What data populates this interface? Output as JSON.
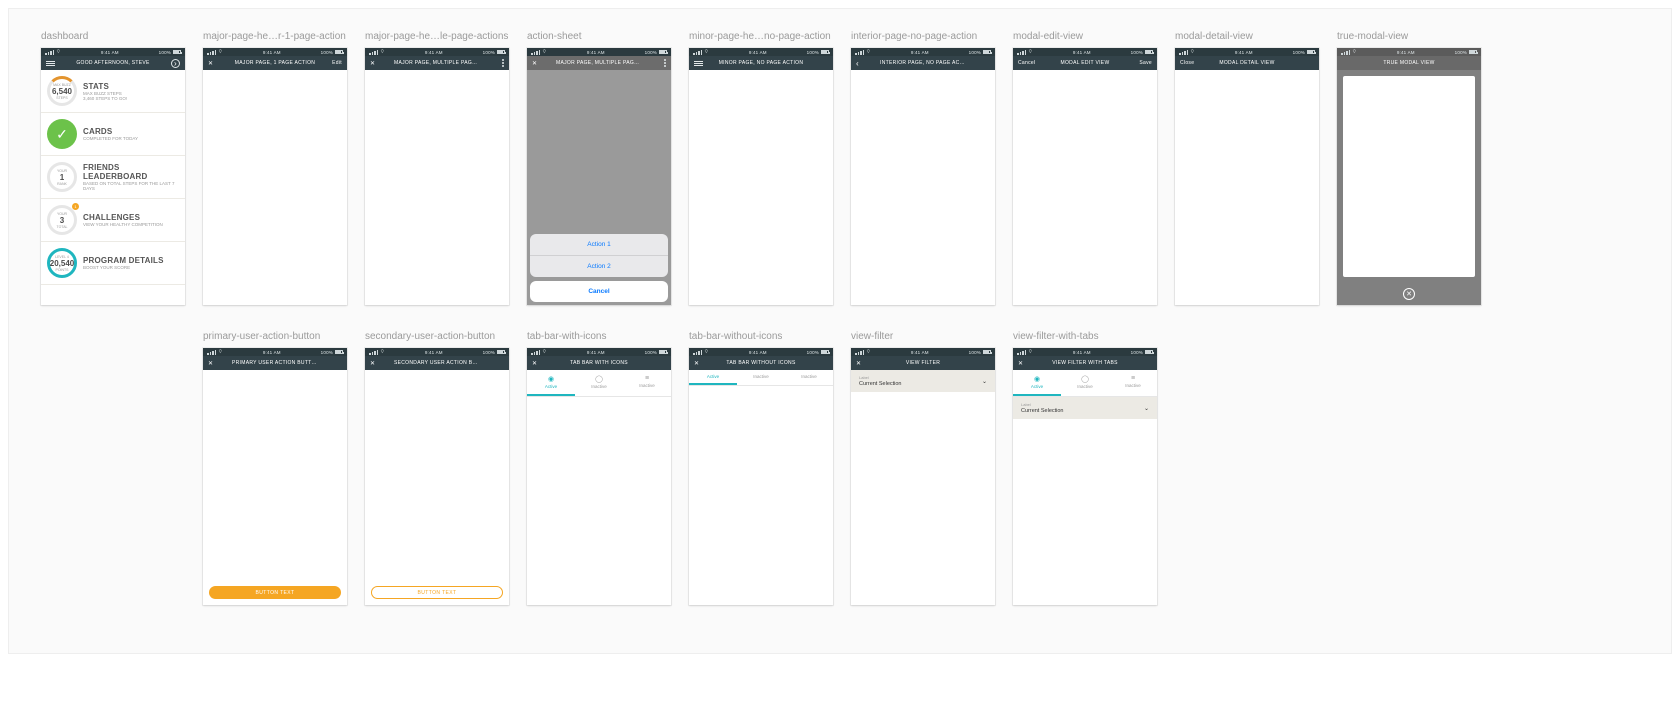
{
  "status": {
    "time": "9:41 AM",
    "battery": "100%"
  },
  "artboards": {
    "row1": [
      {
        "key": "dashboard",
        "title": "dashboard",
        "nav": {
          "leftIcon": "ham",
          "rightIcon": "circle-chev",
          "center": "GOOD AFTERNOON, STEVE"
        },
        "body": "dashboard"
      },
      {
        "key": "major1",
        "title": "major-page-he…r-1-page-action",
        "nav": {
          "leftIcon": "x",
          "rightText": "Edit",
          "center": "MAJOR PAGE, 1 PAGE ACTION"
        }
      },
      {
        "key": "major2",
        "title": "major-page-he…le-page-actions",
        "nav": {
          "leftIcon": "x",
          "rightIcon": "more",
          "center": "MAJOR PAGE, MULTIPLE PAGE ACTIONS"
        }
      },
      {
        "key": "actionsheet",
        "title": "action-sheet",
        "nav": {
          "leftIcon": "x",
          "rightIcon": "more",
          "center": "MAJOR PAGE, MULTIPLE PAGE ACTIONS"
        },
        "body": "actionsheet"
      },
      {
        "key": "minor",
        "title": "minor-page-he…no-page-action",
        "nav": {
          "leftIcon": "ham",
          "center": "MINOR PAGE, NO PAGE ACTION"
        }
      },
      {
        "key": "interior",
        "title": "interior-page-no-page-action",
        "nav": {
          "leftIcon": "back",
          "center": "INTERIOR PAGE, NO PAGE ACTION"
        }
      },
      {
        "key": "modaledit",
        "title": "modal-edit-view",
        "nav": {
          "leftText": "Cancel",
          "rightText": "Save",
          "center": "MODAL EDIT VIEW"
        }
      },
      {
        "key": "modaldetail",
        "title": "modal-detail-view",
        "nav": {
          "leftText": "Close",
          "center": "MODAL DETAIL VIEW"
        }
      },
      {
        "key": "truemodal",
        "title": "true-modal-view",
        "body": "truemodal"
      }
    ],
    "row2": [
      {
        "key": "primarybtn",
        "title": "primary-user-action-button",
        "nav": {
          "leftIcon": "x",
          "center": "PRIMARY USER ACTION BUTTON"
        },
        "body": "primarybtn"
      },
      {
        "key": "secondarybtn",
        "title": "secondary-user-action-button",
        "nav": {
          "leftIcon": "x",
          "center": "SECONDARY USER ACTION BUTTON"
        },
        "body": "secondarybtn"
      },
      {
        "key": "tabicons",
        "title": "tab-bar-with-icons",
        "nav": {
          "leftIcon": "x",
          "center": "TAB BAR WITH ICONS"
        },
        "body": "tabicons"
      },
      {
        "key": "tabnoicons",
        "title": "tab-bar-without-icons",
        "nav": {
          "leftIcon": "x",
          "center": "TAB BAR WITHOUT ICONS"
        },
        "body": "tabnoicons"
      },
      {
        "key": "viewfilter",
        "title": "view-filter",
        "nav": {
          "leftIcon": "x",
          "center": "VIEW FILTER"
        },
        "body": "viewfilter"
      },
      {
        "key": "viewfiltertabs",
        "title": "view-filter-with-tabs",
        "nav": {
          "leftIcon": "x",
          "center": "VIEW FILTER WITH TABS"
        },
        "body": "viewfiltertabs"
      }
    ]
  },
  "dashboard": {
    "items": [
      {
        "badge": "ring-orange",
        "topLabel": "MAX BUZZ",
        "num": "6,540",
        "botLabel": "STEPS",
        "title": "STATS",
        "sub1": "MAX BUZZ STEPS",
        "sub2": "3,460 STEPS TO GO!"
      },
      {
        "badge": "check",
        "title": "CARDS",
        "sub1": "COMPLETED FOR TODAY"
      },
      {
        "badge": "plain",
        "topLabel": "YOUR",
        "num": "1",
        "botLabel": "RANK",
        "title": "FRIENDS LEADERBOARD",
        "sub1": "BASED ON TOTAL STEPS FOR THE LAST 7 DAYS"
      },
      {
        "badge": "plain-notif",
        "topLabel": "YOUR",
        "num": "3",
        "botLabel": "TOTAL",
        "notif": "1",
        "title": "CHALLENGES",
        "sub1": "VIEW YOUR HEALTHY COMPETITION"
      },
      {
        "badge": "ring-teal",
        "topLabel": "LEVEL 4",
        "num": "20,540",
        "botLabel": "POINTS",
        "title": "PROGRAM DETAILS",
        "sub1": "BOOST YOUR SCORE"
      }
    ]
  },
  "actionsheet": {
    "actions": [
      "Action 1",
      "Action 2"
    ],
    "cancel": "Cancel"
  },
  "buttons": {
    "primary": "BUTTON TEXT",
    "secondary": "BUTTON TEXT"
  },
  "tabs": {
    "withIcons": [
      {
        "label": "Active",
        "icon": "◉"
      },
      {
        "label": "Inactive",
        "icon": "◯"
      },
      {
        "label": "Inactive",
        "icon": "≡"
      }
    ],
    "noIcons": [
      "Active",
      "Inactive",
      "Inactive"
    ]
  },
  "filter": {
    "label": "Label",
    "value": "Current Selection"
  },
  "truemodal": {
    "title": "TRUE MODAL VIEW"
  }
}
